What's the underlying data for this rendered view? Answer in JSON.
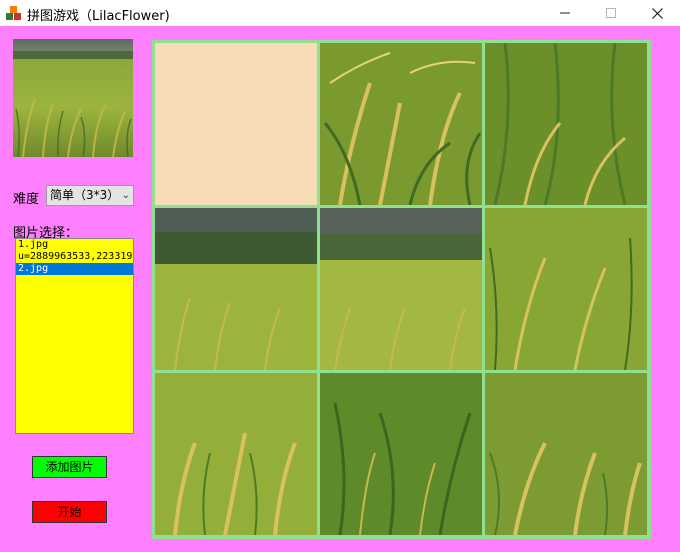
{
  "window": {
    "title": "拼图游戏（LilacFlower)",
    "icons": {
      "app": "puzzle-app-icon",
      "minimize": "minimize-icon",
      "maximize": "maximize-icon",
      "close": "close-icon"
    }
  },
  "sidebar": {
    "difficulty_label": "难度",
    "difficulty_value": "简单（3*3）",
    "image_select_label": "图片选择：",
    "image_list": [
      "1.jpg",
      "u=2889963533,223319",
      "2.jpg"
    ],
    "selected_index": 2,
    "add_button": "添加图片",
    "start_button": "开始"
  },
  "puzzle": {
    "grid": "3*3",
    "empty_tile_position": 1,
    "tile_order": [
      null,
      2,
      3,
      4,
      5,
      6,
      7,
      8,
      9
    ]
  },
  "colors": {
    "background": "#ff80ff",
    "list_background": "#ffff00",
    "selected_item": "#0078d7",
    "add_button": "#00ff00",
    "start_button": "#ff0000",
    "empty_tile": "#f5dcb4",
    "grid_lines": "#90e090"
  }
}
